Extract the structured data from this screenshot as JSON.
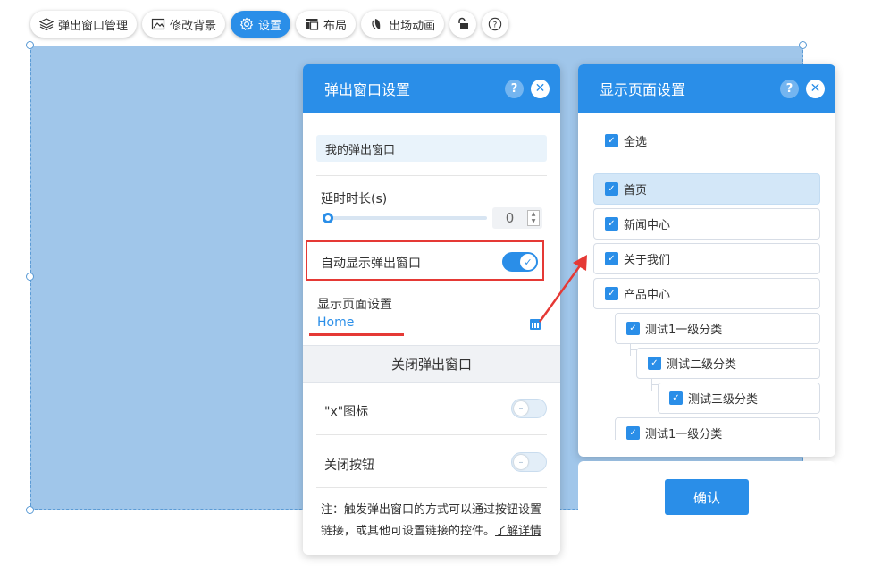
{
  "toolbar": {
    "popup_manage": "弹出窗口管理",
    "change_bg": "修改背景",
    "settings": "设置",
    "layout": "布局",
    "entrance_anim": "出场动画",
    "lock_icon": "unlock-icon",
    "help_icon": "question-icon"
  },
  "popup_panel": {
    "title": "弹出窗口设置",
    "name_value": "我的弹出窗口",
    "delay_label": "延时时长(s)",
    "delay_value": "0",
    "delay_fraction": 0,
    "auto_show_label": "自动显示弹出窗口",
    "auto_show_on": true,
    "display_pages_label": "显示页面设置",
    "display_pages_value": "Home",
    "close_section_title": "关闭弹出窗口",
    "x_icon_label": "\"x\"图标",
    "x_icon_on": false,
    "close_button_label": "关闭按钮",
    "close_button_on": false,
    "note_text": "注：触发弹出窗口的方式可以通过按钮设置链接，或其他可设置链接的控件。",
    "note_link": "了解详情"
  },
  "pages_panel": {
    "title": "显示页面设置",
    "select_all": "全选",
    "items": [
      {
        "label": "首页",
        "level": 0,
        "checked": true,
        "selected": true
      },
      {
        "label": "新闻中心",
        "level": 0,
        "checked": true,
        "selected": false
      },
      {
        "label": "关于我们",
        "level": 0,
        "checked": true,
        "selected": false
      },
      {
        "label": "产品中心",
        "level": 0,
        "checked": true,
        "selected": false
      },
      {
        "label": "测试1一级分类",
        "level": 1,
        "checked": true,
        "selected": false
      },
      {
        "label": "测试二级分类",
        "level": 2,
        "checked": true,
        "selected": false
      },
      {
        "label": "测试三级分类",
        "level": 3,
        "checked": true,
        "selected": false
      },
      {
        "label": "测试1一级分类",
        "level": 1,
        "checked": true,
        "selected": false
      }
    ],
    "confirm_label": "确认"
  },
  "colors": {
    "accent": "#2a8ee8",
    "canvas": "#a0c6ea",
    "annotation_red": "#e53935"
  }
}
